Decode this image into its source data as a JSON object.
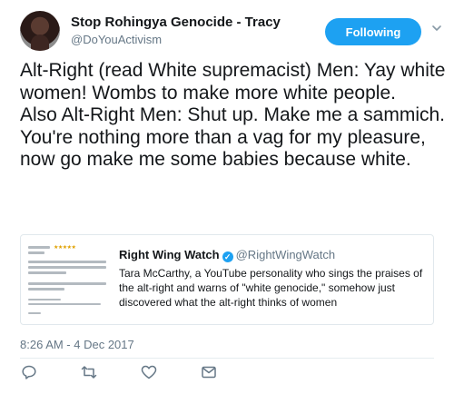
{
  "author": {
    "name": "Stop Rohingya Genocide - Tracy",
    "handle": "@DoYouActivism"
  },
  "follow_button": {
    "label": "Following"
  },
  "tweet": {
    "text": "Alt-Right (read White supremacist) Men: Yay white women! Wombs to make more white people.\nAlso Alt-Right Men: Shut up. Make me a sammich. You're nothing more than a vag for my pleasure, now go make me some babies because white."
  },
  "quoted": {
    "name": "Right Wing Watch",
    "handle": "@RightWingWatch",
    "text": "Tara McCarthy, a YouTube personality who sings the praises of the alt-right and warns of \"white genocide,\" somehow just discovered what the alt-right thinks of women"
  },
  "timestamp": "8:26 AM - 4 Dec 2017",
  "icons": {
    "reply": "reply-icon",
    "retweet": "retweet-icon",
    "like": "heart-icon",
    "dm": "direct-message-icon",
    "more": "chevron-down-icon",
    "verified": "verified-badge-icon"
  },
  "colors": {
    "accent": "#1da1f2",
    "text": "#14171a",
    "muted": "#657786",
    "border": "#e1e8ed"
  }
}
